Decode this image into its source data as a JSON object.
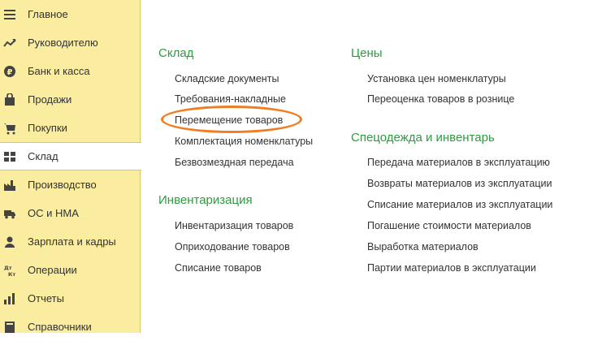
{
  "sidebar": {
    "items": [
      {
        "label": "Главное",
        "icon": "menu-icon"
      },
      {
        "label": "Руководителю",
        "icon": "trend-chart-icon"
      },
      {
        "label": "Банк и касса",
        "icon": "ruble-coin-icon"
      },
      {
        "label": "Продажи",
        "icon": "shopping-bag-icon"
      },
      {
        "label": "Покупки",
        "icon": "shopping-cart-icon"
      },
      {
        "label": "Склад",
        "icon": "warehouse-grid-icon"
      },
      {
        "label": "Производство",
        "icon": "factory-icon"
      },
      {
        "label": "ОС и НМА",
        "icon": "truck-icon"
      },
      {
        "label": "Зарплата и кадры",
        "icon": "person-icon"
      },
      {
        "label": "Операции",
        "icon": "debit-credit-icon",
        "glyph_top": "Дт",
        "glyph_bottom": "Кт"
      },
      {
        "label": "Отчеты",
        "icon": "report-chart-icon"
      },
      {
        "label": "Справочники",
        "icon": "book-icon"
      }
    ],
    "active_label": "Склад"
  },
  "content": {
    "sklad": {
      "title": "Склад",
      "links": [
        "Складские документы",
        "Требования-накладные",
        "Перемещение товаров",
        "Комплектация номенклатуры",
        "Безвозмездная передача"
      ]
    },
    "inventarizatsiya": {
      "title": "Инвентаризация",
      "links": [
        "Инвентаризация товаров",
        "Оприходование товаров",
        "Списание товаров"
      ]
    },
    "tseny": {
      "title": "Цены",
      "links": [
        "Установка цен номенклатуры",
        "Переоценка товаров в рознице"
      ]
    },
    "specodezhda": {
      "title": "Спецодежда и инвентарь",
      "links": [
        "Передача материалов в эксплуатацию",
        "Возвраты материалов из эксплуатации",
        "Списание материалов из эксплуатации",
        "Погашение стоимости материалов",
        "Выработка материалов",
        "Партии материалов в эксплуатации"
      ]
    }
  },
  "colors": {
    "sidebar_bg": "#fbeda0",
    "section_title": "#2c9c3f",
    "highlight": "#f07d22",
    "text": "#333333"
  }
}
